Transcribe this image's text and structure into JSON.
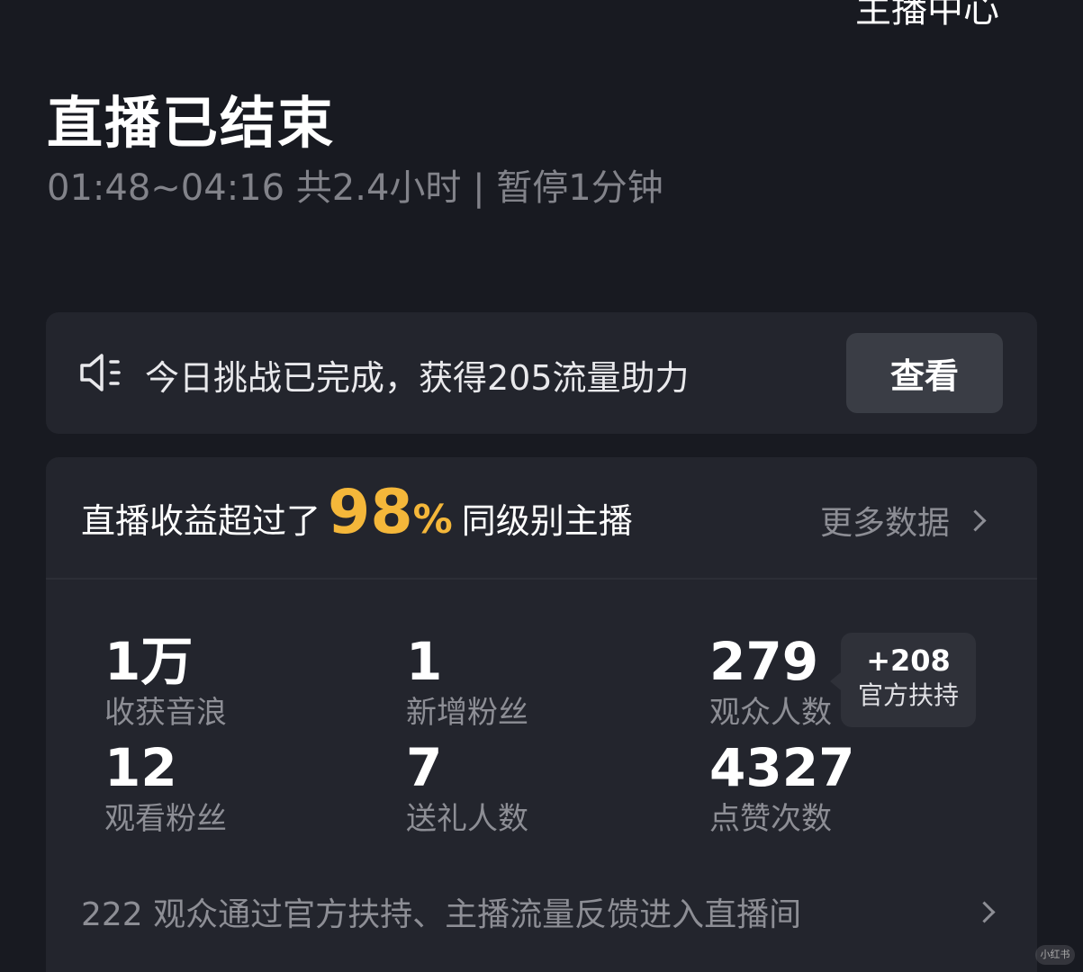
{
  "header": {
    "top_link": "主播中心",
    "title": "直播已结束",
    "subtitle": "01:48~04:16 共2.4小时 | 暂停1分钟"
  },
  "challenge": {
    "text": "今日挑战已完成，获得205流量助力",
    "button_label": "查看",
    "icon": "speaker-icon"
  },
  "ranking": {
    "prefix": "直播收益超过了",
    "percent_value": "98",
    "percent_sign": "%",
    "suffix": "同级别主播",
    "more_label": "更多数据"
  },
  "stats": [
    {
      "value": "1万",
      "label": "收获音浪"
    },
    {
      "value": "1",
      "label": "新增粉丝"
    },
    {
      "value": "279",
      "label": "观众人数"
    },
    {
      "value": "12",
      "label": "观看粉丝"
    },
    {
      "value": "7",
      "label": "送礼人数"
    },
    {
      "value": "4327",
      "label": "点赞次数"
    }
  ],
  "support_badge": {
    "value": "+208",
    "label": "官方扶持"
  },
  "footer": {
    "text": "222 观众通过官方扶持、主播流量反馈进入直播间"
  },
  "watermark": "小红书",
  "colors": {
    "background": "#181a21",
    "card": "#23252d",
    "accent": "#f4b73a",
    "muted_text": "#8d8e95"
  }
}
